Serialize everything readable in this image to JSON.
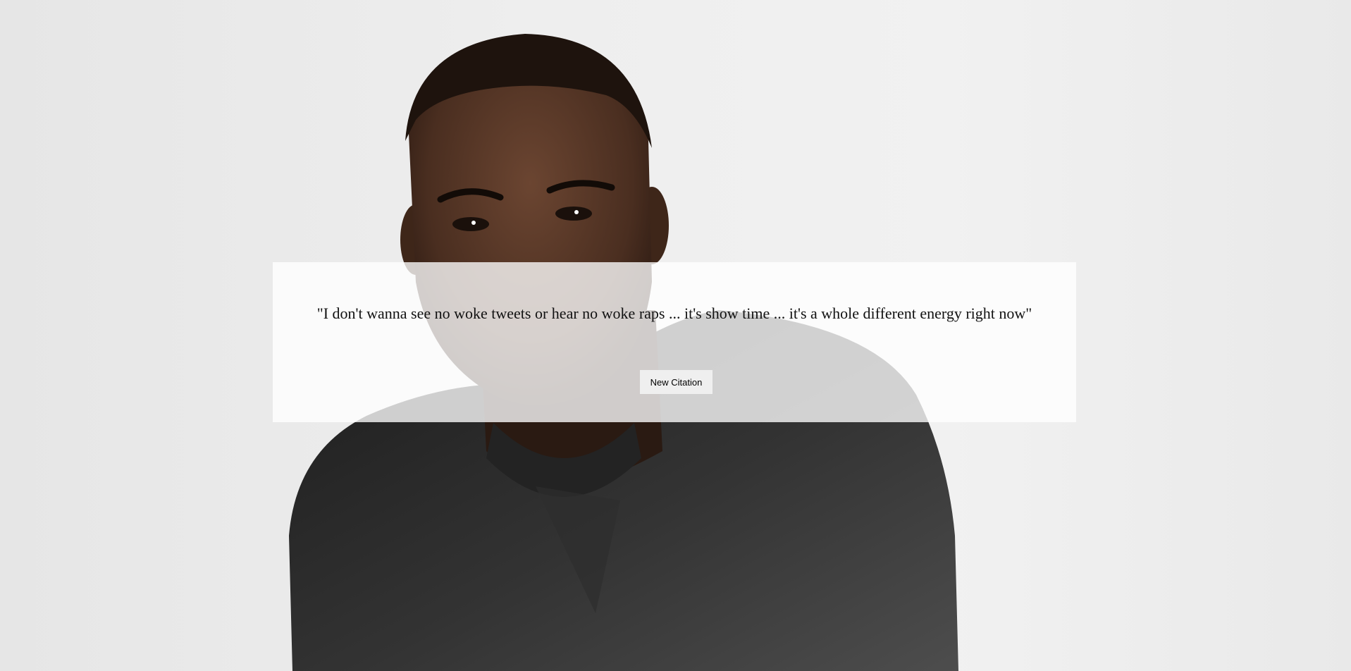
{
  "quote": {
    "text": "\"I don't wanna see no woke tweets or hear no woke raps ... it's show time ... it's a whole different energy right now\""
  },
  "actions": {
    "new_citation_label": "New Citation"
  },
  "colors": {
    "background": "#ededed",
    "card": "#ffffff",
    "button": "#efefef",
    "text": "#111111"
  }
}
